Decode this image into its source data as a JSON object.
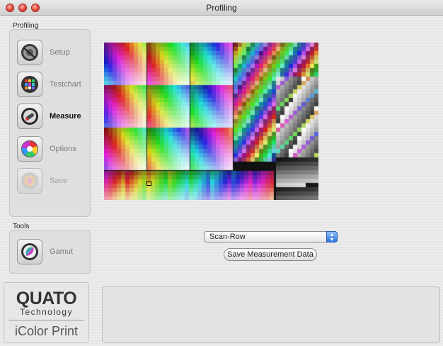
{
  "window": {
    "title": "Profiling"
  },
  "sidebar": {
    "profiling_label": "Profiling",
    "tools_label": "Tools",
    "steps": [
      {
        "id": "setup",
        "label": "Setup",
        "state": "normal"
      },
      {
        "id": "testchart",
        "label": "Testchart",
        "state": "normal"
      },
      {
        "id": "measure",
        "label": "Measure",
        "state": "active"
      },
      {
        "id": "options",
        "label": "Options",
        "state": "normal"
      },
      {
        "id": "save",
        "label": "Save",
        "state": "disabled"
      }
    ],
    "tools": [
      {
        "id": "gamut",
        "label": "Gamut"
      }
    ]
  },
  "measurement": {
    "mode_selected": "Scan-Row",
    "save_button": "Save Measurement Data"
  },
  "branding": {
    "brand": "QUATO",
    "sub": "Technology",
    "product": "iColor Print"
  },
  "colors": {
    "accent": "#2a74e0",
    "close": "#e8453a"
  }
}
